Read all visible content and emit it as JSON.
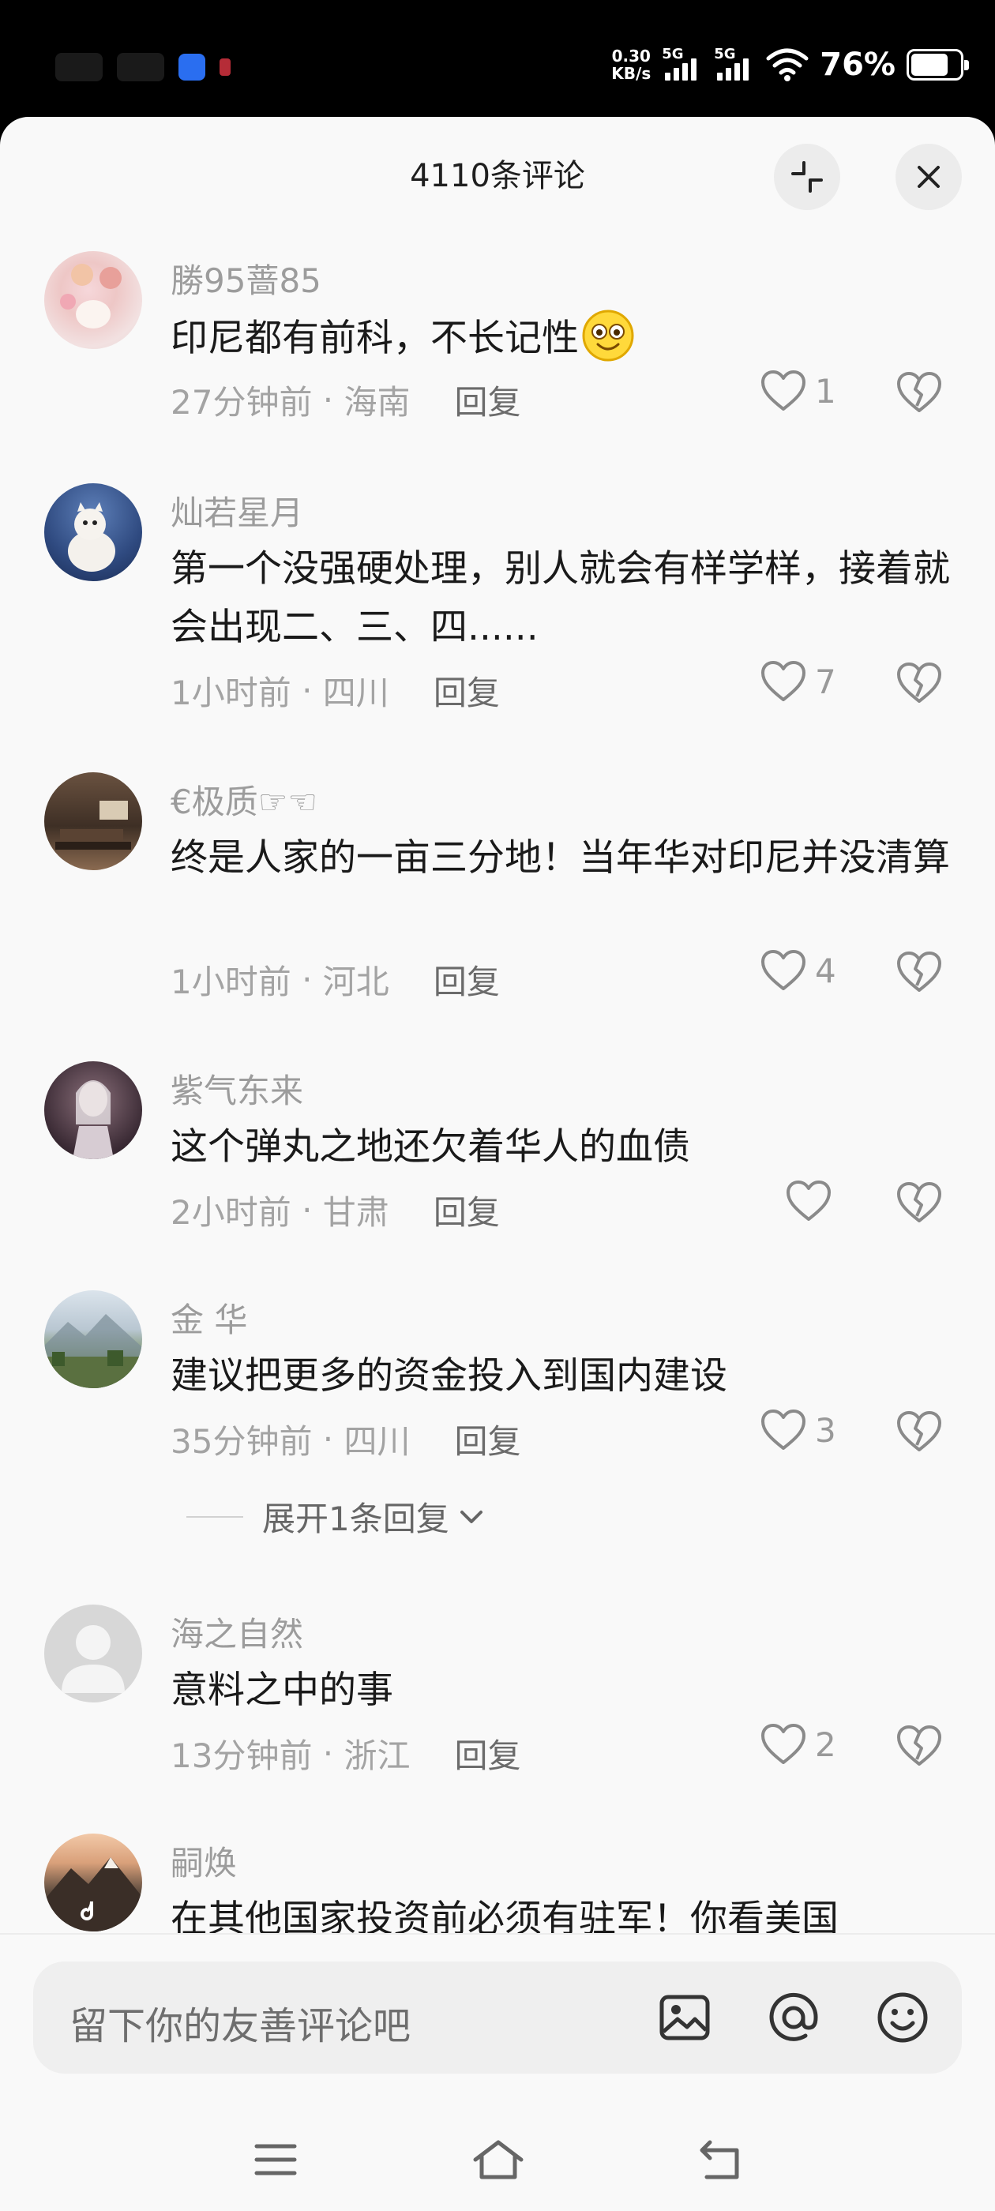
{
  "status_bar": {
    "net_speed_value": "0.30",
    "net_speed_unit": "KB/s",
    "signal1_label": "5G",
    "signal2_label": "5G",
    "battery_percent": "76%"
  },
  "header": {
    "title": "4110条评论",
    "collapse_icon": "collapse-icon",
    "close_icon": "close-icon"
  },
  "comments": [
    {
      "username": "勝95蔷85",
      "text": "印尼都有前科，不长记性",
      "time": "27分钟前",
      "location": "海南",
      "reply_label": "回复",
      "likes": "1",
      "emoji": "smile-emoji"
    },
    {
      "username": "灿若星月",
      "text": "第一个没强硬处理，别人就会有样学样，接着就会出现二、三、四......",
      "time": "1小时前",
      "location": "四川",
      "reply_label": "回复",
      "likes": "7"
    },
    {
      "username": "€极质☞☜",
      "text": "终是人家的一亩三分地！当年华对印尼并没清算",
      "time": "1小时前",
      "location": "河北",
      "reply_label": "回复",
      "likes": "4"
    },
    {
      "username": "紫气东来",
      "text": "这个弹丸之地还欠着华人的血债",
      "time": "2小时前",
      "location": "甘肃",
      "reply_label": "回复",
      "likes": ""
    },
    {
      "username": "金 华",
      "text": "建议把更多的资金投入到国内建设",
      "time": "35分钟前",
      "location": "四川",
      "reply_label": "回复",
      "likes": "3",
      "expand_label": "展开1条回复"
    },
    {
      "username": "海之自然",
      "text": "意料之中的事",
      "time": "13分钟前",
      "location": "浙江",
      "reply_label": "回复",
      "likes": "2"
    },
    {
      "username": "嗣焕",
      "text": "在其他国家投资前必须有驻军！你看美国",
      "time": "",
      "location": "",
      "reply_label": "",
      "likes": ""
    }
  ],
  "input_bar": {
    "placeholder": "留下你的友善评论吧",
    "icons": [
      "image-icon",
      "at-icon",
      "emoji-icon"
    ]
  },
  "nav_bar": {
    "icons": [
      "menu-icon",
      "home-icon",
      "back-icon"
    ]
  },
  "colors": {
    "sheet_bg": "#f9f9f9",
    "text_primary": "#1a1a1a",
    "text_secondary": "#a3a3a3"
  }
}
